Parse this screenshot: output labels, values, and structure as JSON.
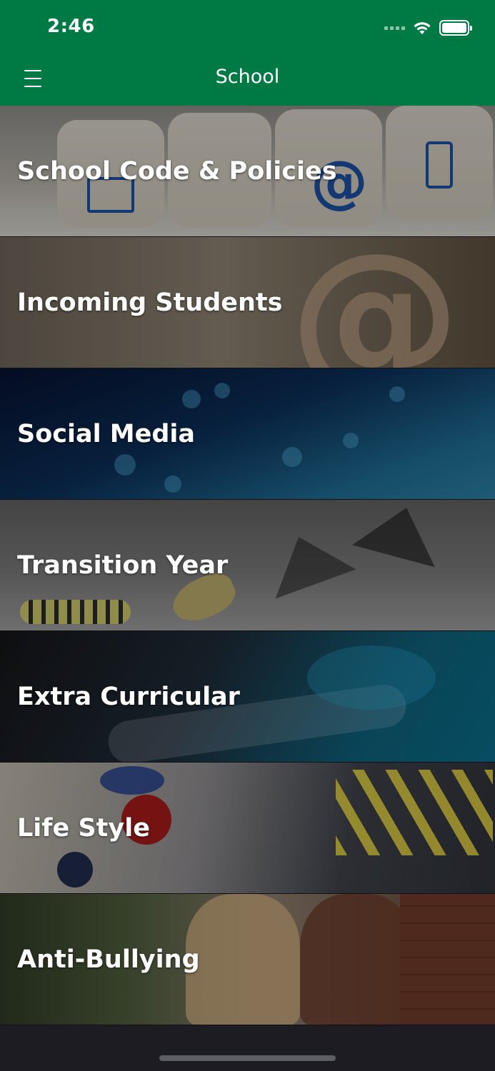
{
  "status_bar": {
    "time": "2:46"
  },
  "nav": {
    "title": "School"
  },
  "items": [
    {
      "label": "School Code & Policies"
    },
    {
      "label": "Incoming Students"
    },
    {
      "label": "Social Media"
    },
    {
      "label": "Transition Year"
    },
    {
      "label": "Extra Curricular"
    },
    {
      "label": "Life Style"
    },
    {
      "label": "Anti-Bullying"
    }
  ],
  "colors": {
    "nav_background": "#007a45",
    "bottom_background": "#1c1c22"
  }
}
